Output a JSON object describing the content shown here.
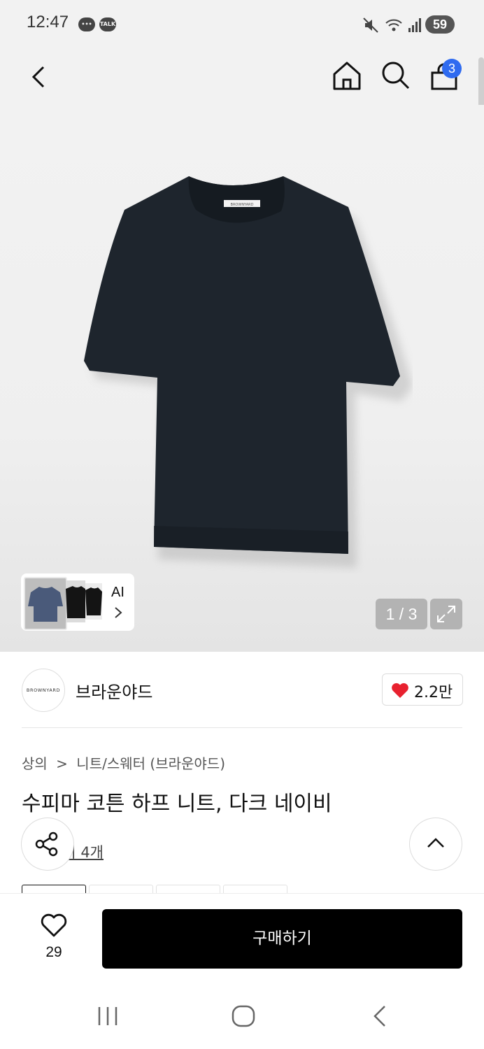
{
  "status_bar": {
    "time": "12:47",
    "talk_badge": "TALK",
    "battery": "59"
  },
  "header": {
    "cart_count": "3"
  },
  "product_image": {
    "shirt_label": "BROWNYARD",
    "ai_label": "AI",
    "counter": "1 / 3",
    "shirt_color": "#1e252d"
  },
  "brand": {
    "logo_text": "BROWNYARD",
    "name": "브라운야드",
    "likes": "2.2만"
  },
  "product": {
    "breadcrumb": {
      "category": "상의",
      "separator": ">",
      "subcategory": "니트/스웨터 (브라운야드)"
    },
    "title": "수피마 코튼 하프 니트, 다크 네이비",
    "review_link": "후기 4개"
  },
  "bottom_bar": {
    "wish_count": "29",
    "buy_label": "구매하기"
  },
  "colors": {
    "accent_blue": "#2f6bf0",
    "heart_red": "#e8212f",
    "buy_button": "#000000"
  }
}
